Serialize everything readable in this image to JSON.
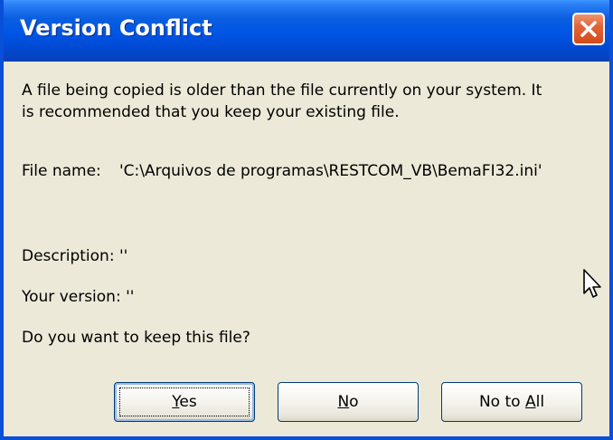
{
  "window": {
    "title": "Version Conflict",
    "close_icon": "close-icon"
  },
  "message": {
    "line1": "A file being copied is older than the file currently on your system.  It",
    "line2": "is recommended that you keep your existing file."
  },
  "file": {
    "label": "File name:",
    "value": "'C:\\Arquivos de programas\\RESTCOM_VB\\BemaFI32.ini'"
  },
  "description": {
    "text": "Description:  ''"
  },
  "version": {
    "text": "Your version: ''"
  },
  "question": {
    "text": "Do you want to keep this file?"
  },
  "buttons": {
    "yes": {
      "first": "Y",
      "rest": "es"
    },
    "no": {
      "first": "N",
      "rest": "o"
    },
    "no_to_all": {
      "prefix": "No to ",
      "accel": "A",
      "rest": "ll"
    }
  },
  "colors": {
    "title_bar": "#0055e5",
    "dialog_bg": "#ece9d8",
    "close_button": "#e3653a"
  }
}
